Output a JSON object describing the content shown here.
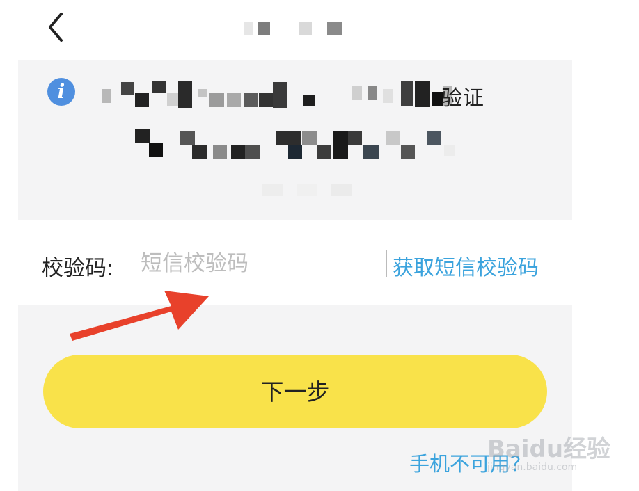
{
  "header": {
    "back_icon": "chevron-left-icon"
  },
  "notice": {
    "info_icon": "info-icon",
    "info_glyph": "i",
    "verify_suffix": "验证"
  },
  "code_row": {
    "label": "校验码:",
    "input_value": "",
    "input_placeholder": "短信校验码",
    "get_code_label": "获取短信校验码"
  },
  "actions": {
    "next_label": "下一步",
    "phone_unavailable_label": "手机不可用？"
  },
  "watermark": {
    "main": "Baidu经验",
    "sub": "jingyan.baidu.com"
  },
  "colors": {
    "accent_yellow": "#f9e24a",
    "link_blue": "#3ba3dd",
    "info_blue": "#4f8fdf",
    "panel_gray": "#f4f4f5",
    "annotation_red": "#e8412b"
  }
}
